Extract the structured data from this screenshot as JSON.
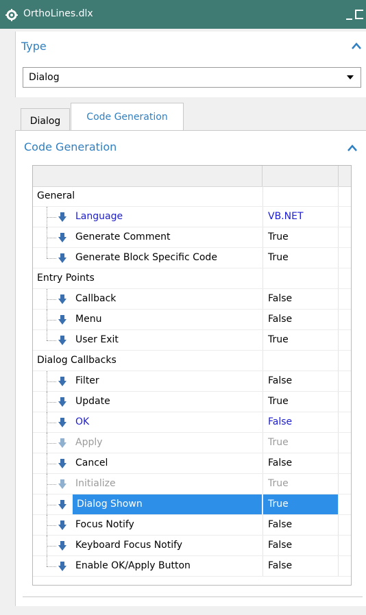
{
  "window": {
    "title": "OrthoLines.dlx"
  },
  "type_section": {
    "header": "Type",
    "dropdown_value": "Dialog"
  },
  "tabs": [
    {
      "label": "Dialog",
      "active": false
    },
    {
      "label": "Code Generation",
      "active": true
    }
  ],
  "code_generation": {
    "header": "Code Generation",
    "rows": [
      {
        "kind": "group",
        "label": "General",
        "value": ""
      },
      {
        "kind": "item",
        "label": "Language",
        "value": "VB.NET",
        "style": "blue"
      },
      {
        "kind": "item",
        "label": "Generate Comment",
        "value": "True",
        "style": "normal"
      },
      {
        "kind": "item",
        "label": "Generate Block Specific Code",
        "value": "True",
        "style": "normal",
        "last": true
      },
      {
        "kind": "group",
        "label": "Entry Points",
        "value": ""
      },
      {
        "kind": "item",
        "label": "Callback",
        "value": "False",
        "style": "normal"
      },
      {
        "kind": "item",
        "label": "Menu",
        "value": "False",
        "style": "normal"
      },
      {
        "kind": "item",
        "label": "User Exit",
        "value": "True",
        "style": "normal",
        "last": true
      },
      {
        "kind": "group",
        "label": "Dialog Callbacks",
        "value": ""
      },
      {
        "kind": "item",
        "label": "Filter",
        "value": "False",
        "style": "normal"
      },
      {
        "kind": "item",
        "label": "Update",
        "value": "True",
        "style": "normal"
      },
      {
        "kind": "item",
        "label": "OK",
        "value": "False",
        "style": "blue"
      },
      {
        "kind": "item",
        "label": "Apply",
        "value": "True",
        "style": "disabled"
      },
      {
        "kind": "item",
        "label": "Cancel",
        "value": "False",
        "style": "normal"
      },
      {
        "kind": "item",
        "label": "Initialize",
        "value": "True",
        "style": "disabled"
      },
      {
        "kind": "item",
        "label": "Dialog Shown",
        "value": "True",
        "style": "selected"
      },
      {
        "kind": "item",
        "label": "Focus Notify",
        "value": "False",
        "style": "normal"
      },
      {
        "kind": "item",
        "label": "Keyboard Focus Notify",
        "value": "False",
        "style": "normal"
      },
      {
        "kind": "item",
        "label": "Enable OK/Apply Button",
        "value": "False",
        "style": "normal",
        "last": true
      }
    ]
  },
  "colors": {
    "titlebar": "#3f7a73",
    "accent": "#2f80c2",
    "selection": "#2d8fe8",
    "link_text": "#1c1cd0",
    "disabled_text": "#9b9b9b"
  },
  "icons": [
    "gear-icon",
    "minimize-icon",
    "maximize-icon",
    "chevron-up-icon",
    "dropdown-arrow-icon",
    "down-arrow-icon"
  ]
}
